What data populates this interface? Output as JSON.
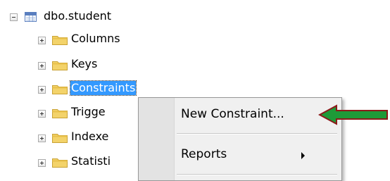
{
  "tree": {
    "table_node": {
      "label": "dbo.student",
      "expander": "collapse",
      "icon": "table-icon"
    },
    "children": [
      {
        "label": "Columns",
        "expander": "expand",
        "icon": "folder-icon"
      },
      {
        "label": "Keys",
        "expander": "expand",
        "icon": "folder-icon"
      },
      {
        "label": "Constraints",
        "expander": "expand",
        "icon": "folder-icon",
        "selected": true
      },
      {
        "label": "Trigge",
        "expander": "expand",
        "icon": "folder-icon"
      },
      {
        "label": "Indexe",
        "expander": "expand",
        "icon": "folder-icon"
      },
      {
        "label": "Statisti",
        "expander": "expand",
        "icon": "folder-icon"
      }
    ]
  },
  "context_menu": {
    "items": [
      {
        "label": "New Constraint...",
        "highlighted": true
      },
      {
        "label": "Reports",
        "has_submenu": true
      }
    ]
  },
  "annotation": {
    "arrow_icon": "left-arrow-icon",
    "fill_color": "#1e9a38",
    "outline_color": "#8b1a1a"
  },
  "colors": {
    "selection": "#3399ff",
    "folder": "#f3d36a",
    "menu_background": "#f0f0f0"
  }
}
